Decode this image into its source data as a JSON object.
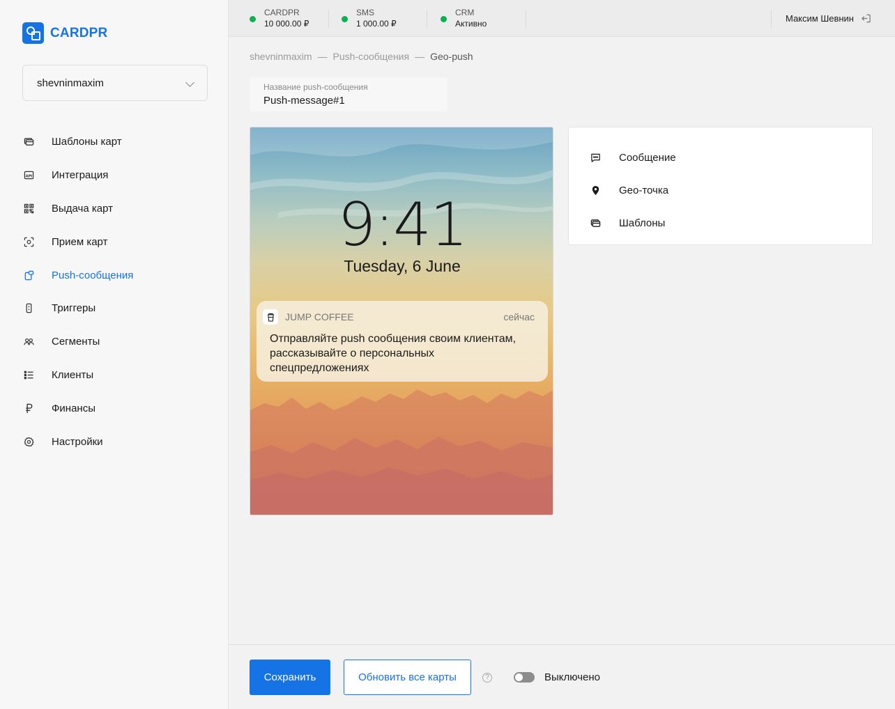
{
  "brand": {
    "name": "CARDPR",
    "accent": "#1673e6"
  },
  "account": {
    "selected": "shevninmaxim"
  },
  "nav": {
    "items": [
      {
        "label": "Шаблоны карт",
        "icon": "card-template-icon"
      },
      {
        "label": "Интеграция",
        "icon": "api-icon"
      },
      {
        "label": "Выдача карт",
        "icon": "qr-code-icon"
      },
      {
        "label": "Прием карт",
        "icon": "scan-icon"
      },
      {
        "label": "Push-сообщения",
        "icon": "push-icon",
        "active": true
      },
      {
        "label": "Триггеры",
        "icon": "trigger-icon"
      },
      {
        "label": "Сегменты",
        "icon": "segments-icon"
      },
      {
        "label": "Клиенты",
        "icon": "clients-list-icon"
      },
      {
        "label": "Финансы",
        "icon": "ruble-icon"
      },
      {
        "label": "Настройки",
        "icon": "gear-icon"
      }
    ]
  },
  "topbar": {
    "stats": [
      {
        "label": "CARDPR",
        "value": "10 000.00 ₽",
        "status_color": "#0bb04f"
      },
      {
        "label": "SMS",
        "value": "1 000.00 ₽",
        "status_color": "#0bb04f"
      },
      {
        "label": "CRM",
        "value": "Активно",
        "status_color": "#0bb04f"
      }
    ],
    "user": "Максим Шевнин"
  },
  "breadcrumb": {
    "items": [
      "shevninmaxim",
      "Push-сообщения",
      "Geo-push"
    ],
    "separator": "—"
  },
  "name_field": {
    "label": "Название push-сообщения",
    "value": "Push-message#1"
  },
  "preview": {
    "time": "9:41",
    "date": "Tuesday, 6 June",
    "notification": {
      "app": "JUMP COFFEE",
      "time": "сейчас",
      "text": "Отправляйте push сообщения своим клиентам, рассказывайте о персональных спецпредложениях"
    }
  },
  "panel": {
    "items": [
      {
        "label": "Сообщение",
        "icon": "message-icon"
      },
      {
        "label": "Geo-точка",
        "icon": "map-pin-icon"
      },
      {
        "label": "Шаблоны",
        "icon": "templates-icon"
      }
    ]
  },
  "footer": {
    "save_label": "Сохранить",
    "update_label": "Обновить все карты",
    "help_symbol": "?",
    "toggle_label": "Выключено",
    "toggle_on": false
  }
}
